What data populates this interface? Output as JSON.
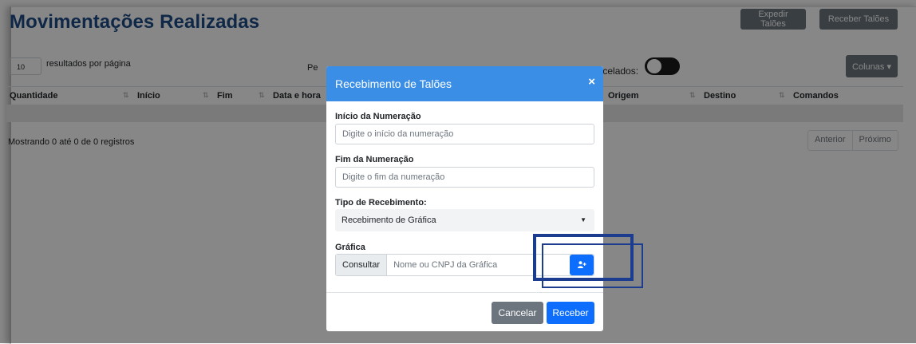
{
  "page": {
    "title": "Movimentações Realizadas",
    "expedir_label": "Expedir Talões",
    "receber_label": "Receber Talões",
    "per_page_value": "10",
    "per_page_label": "resultados por página",
    "periodo_partial": "Pe",
    "cancelados_label": "ancelados:",
    "colunas_label": "Colunas ▾",
    "columns": [
      "Quantidade",
      "Início",
      "Fim",
      "Data e hora",
      "Origem",
      "Destino",
      "Comandos"
    ],
    "info": "Mostrando 0 até 0 de 0 registros",
    "pager": {
      "prev": "Anterior",
      "next": "Próximo"
    }
  },
  "modal": {
    "title": "Recebimento de Talões",
    "close": "×",
    "inicio_label": "Início da Numeração",
    "inicio_placeholder": "Digite o início da numeração",
    "fim_label": "Fim da Numeração",
    "fim_placeholder": "Digite o fim da numeração",
    "tipo_label": "Tipo de Recebimento:",
    "tipo_value": "Recebimento de Gráfica",
    "grafica_label": "Gráfica",
    "consultar_label": "Consultar",
    "grafica_placeholder": "Nome ou CNPJ da Gráfica",
    "add_icon": "user-plus-icon",
    "cancel_label": "Cancelar",
    "submit_label": "Receber"
  },
  "colors": {
    "title": "#1f4c87",
    "header": "#3a8ee6",
    "primary": "#0d6efd",
    "secondary": "#6c757d",
    "highlight": "#1c3d8f"
  }
}
